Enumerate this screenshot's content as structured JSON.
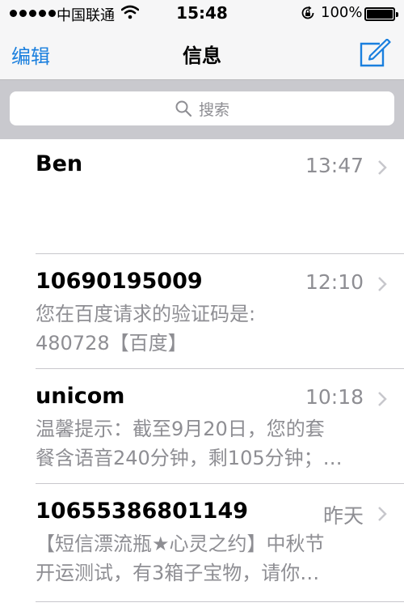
{
  "status_bar": {
    "carrier": "中国联通",
    "time": "15:48",
    "battery": "100%"
  },
  "nav": {
    "edit_label": "编辑",
    "title": "信息"
  },
  "search": {
    "placeholder": "搜索"
  },
  "messages": [
    {
      "sender": "Ben",
      "time": "13:47",
      "preview_lines": [
        "",
        ""
      ]
    },
    {
      "sender": "10690195009",
      "time": "12:10",
      "preview_lines": [
        "您在百度请求的验证码是:",
        "480728【百度】"
      ]
    },
    {
      "sender": "unicom",
      "time": "10:18",
      "preview_lines": [
        "温馨提示：截至9月20日，您的套",
        "餐含语音240分钟，剩105分钟；…"
      ]
    },
    {
      "sender": "10655386801149",
      "time": "昨天",
      "preview_lines": [
        "【短信漂流瓶★心灵之约】中秋节",
        "开运测试，有3箱子宝物，请你…"
      ]
    }
  ],
  "colors": {
    "accent": "#1a7fde",
    "secondary_text": "#8e8e93",
    "search_bar_bg": "#c9c9ce"
  },
  "icons": [
    "signal-dots-icon",
    "wifi-icon",
    "rotation-lock-icon",
    "battery-icon",
    "compose-icon",
    "search-icon",
    "chevron-right-icon"
  ]
}
